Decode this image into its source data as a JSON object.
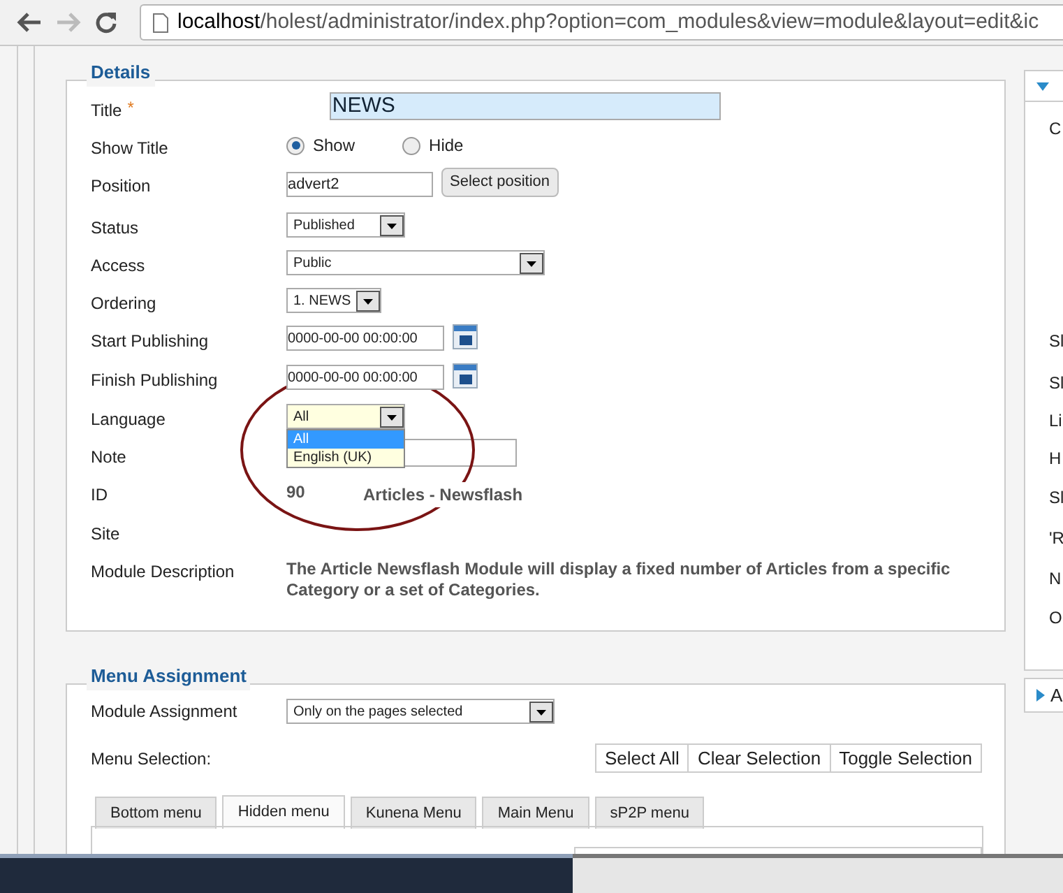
{
  "browser": {
    "url_host": "localhost",
    "url_path": "/holest/administrator/index.php?option=com_modules&view=module&layout=edit&ic"
  },
  "details": {
    "legend": "Details",
    "fields": [
      {
        "kind": "text",
        "label": "Title",
        "required_mark": "*",
        "value": "NEWS"
      },
      {
        "kind": "radio",
        "label": "Show Title",
        "options": [
          {
            "label": "Show",
            "selected": true
          },
          {
            "label": "Hide",
            "selected": false
          }
        ]
      },
      {
        "kind": "position",
        "label": "Position",
        "value": "advert2",
        "button": "Select position"
      },
      {
        "kind": "select",
        "label": "Status",
        "value": "Published"
      },
      {
        "kind": "select",
        "label": "Access",
        "value": "Public"
      },
      {
        "kind": "select",
        "label": "Ordering",
        "value": "1. NEWS"
      },
      {
        "kind": "date",
        "label": "Start Publishing",
        "value": "0000-00-00 00:00:00"
      },
      {
        "kind": "date",
        "label": "Finish Publishing",
        "value": "0000-00-00 00:00:00"
      },
      {
        "kind": "select",
        "label": "Language",
        "value": "All",
        "expanded": true,
        "options": [
          {
            "label": "All",
            "selected": true
          },
          {
            "label": "English (UK)",
            "selected": false
          }
        ]
      },
      {
        "kind": "text",
        "label": "Note"
      },
      {
        "kind": "static",
        "label": "ID",
        "value": "90",
        "extra": "Articles - Newsflash"
      },
      {
        "kind": "static",
        "label": "Site"
      },
      {
        "kind": "static",
        "label": "Module Description",
        "value": "The Article Newsflash Module will display a fixed number of Articles from a specific Category or a set of Categories."
      }
    ]
  },
  "side_panel": {
    "items": [
      "C",
      "Sl",
      "Sl",
      "Li",
      "H",
      "Sl",
      "'R",
      "N",
      "O"
    ],
    "second_header": "A"
  },
  "menu_assignment": {
    "legend": "Menu Assignment",
    "assignment_label": "Module Assignment",
    "assignment_value": "Only on the pages selected",
    "selection_label": "Menu Selection:",
    "buttons": [
      "Select All",
      "Clear Selection",
      "Toggle Selection"
    ],
    "tabs": [
      {
        "label": "Bottom menu",
        "selected": false
      },
      {
        "label": "Hidden menu",
        "selected": true
      },
      {
        "label": "Kunena Menu",
        "selected": false
      },
      {
        "label": "Main Menu",
        "selected": false
      },
      {
        "label": "sP2P menu",
        "selected": false
      }
    ]
  }
}
